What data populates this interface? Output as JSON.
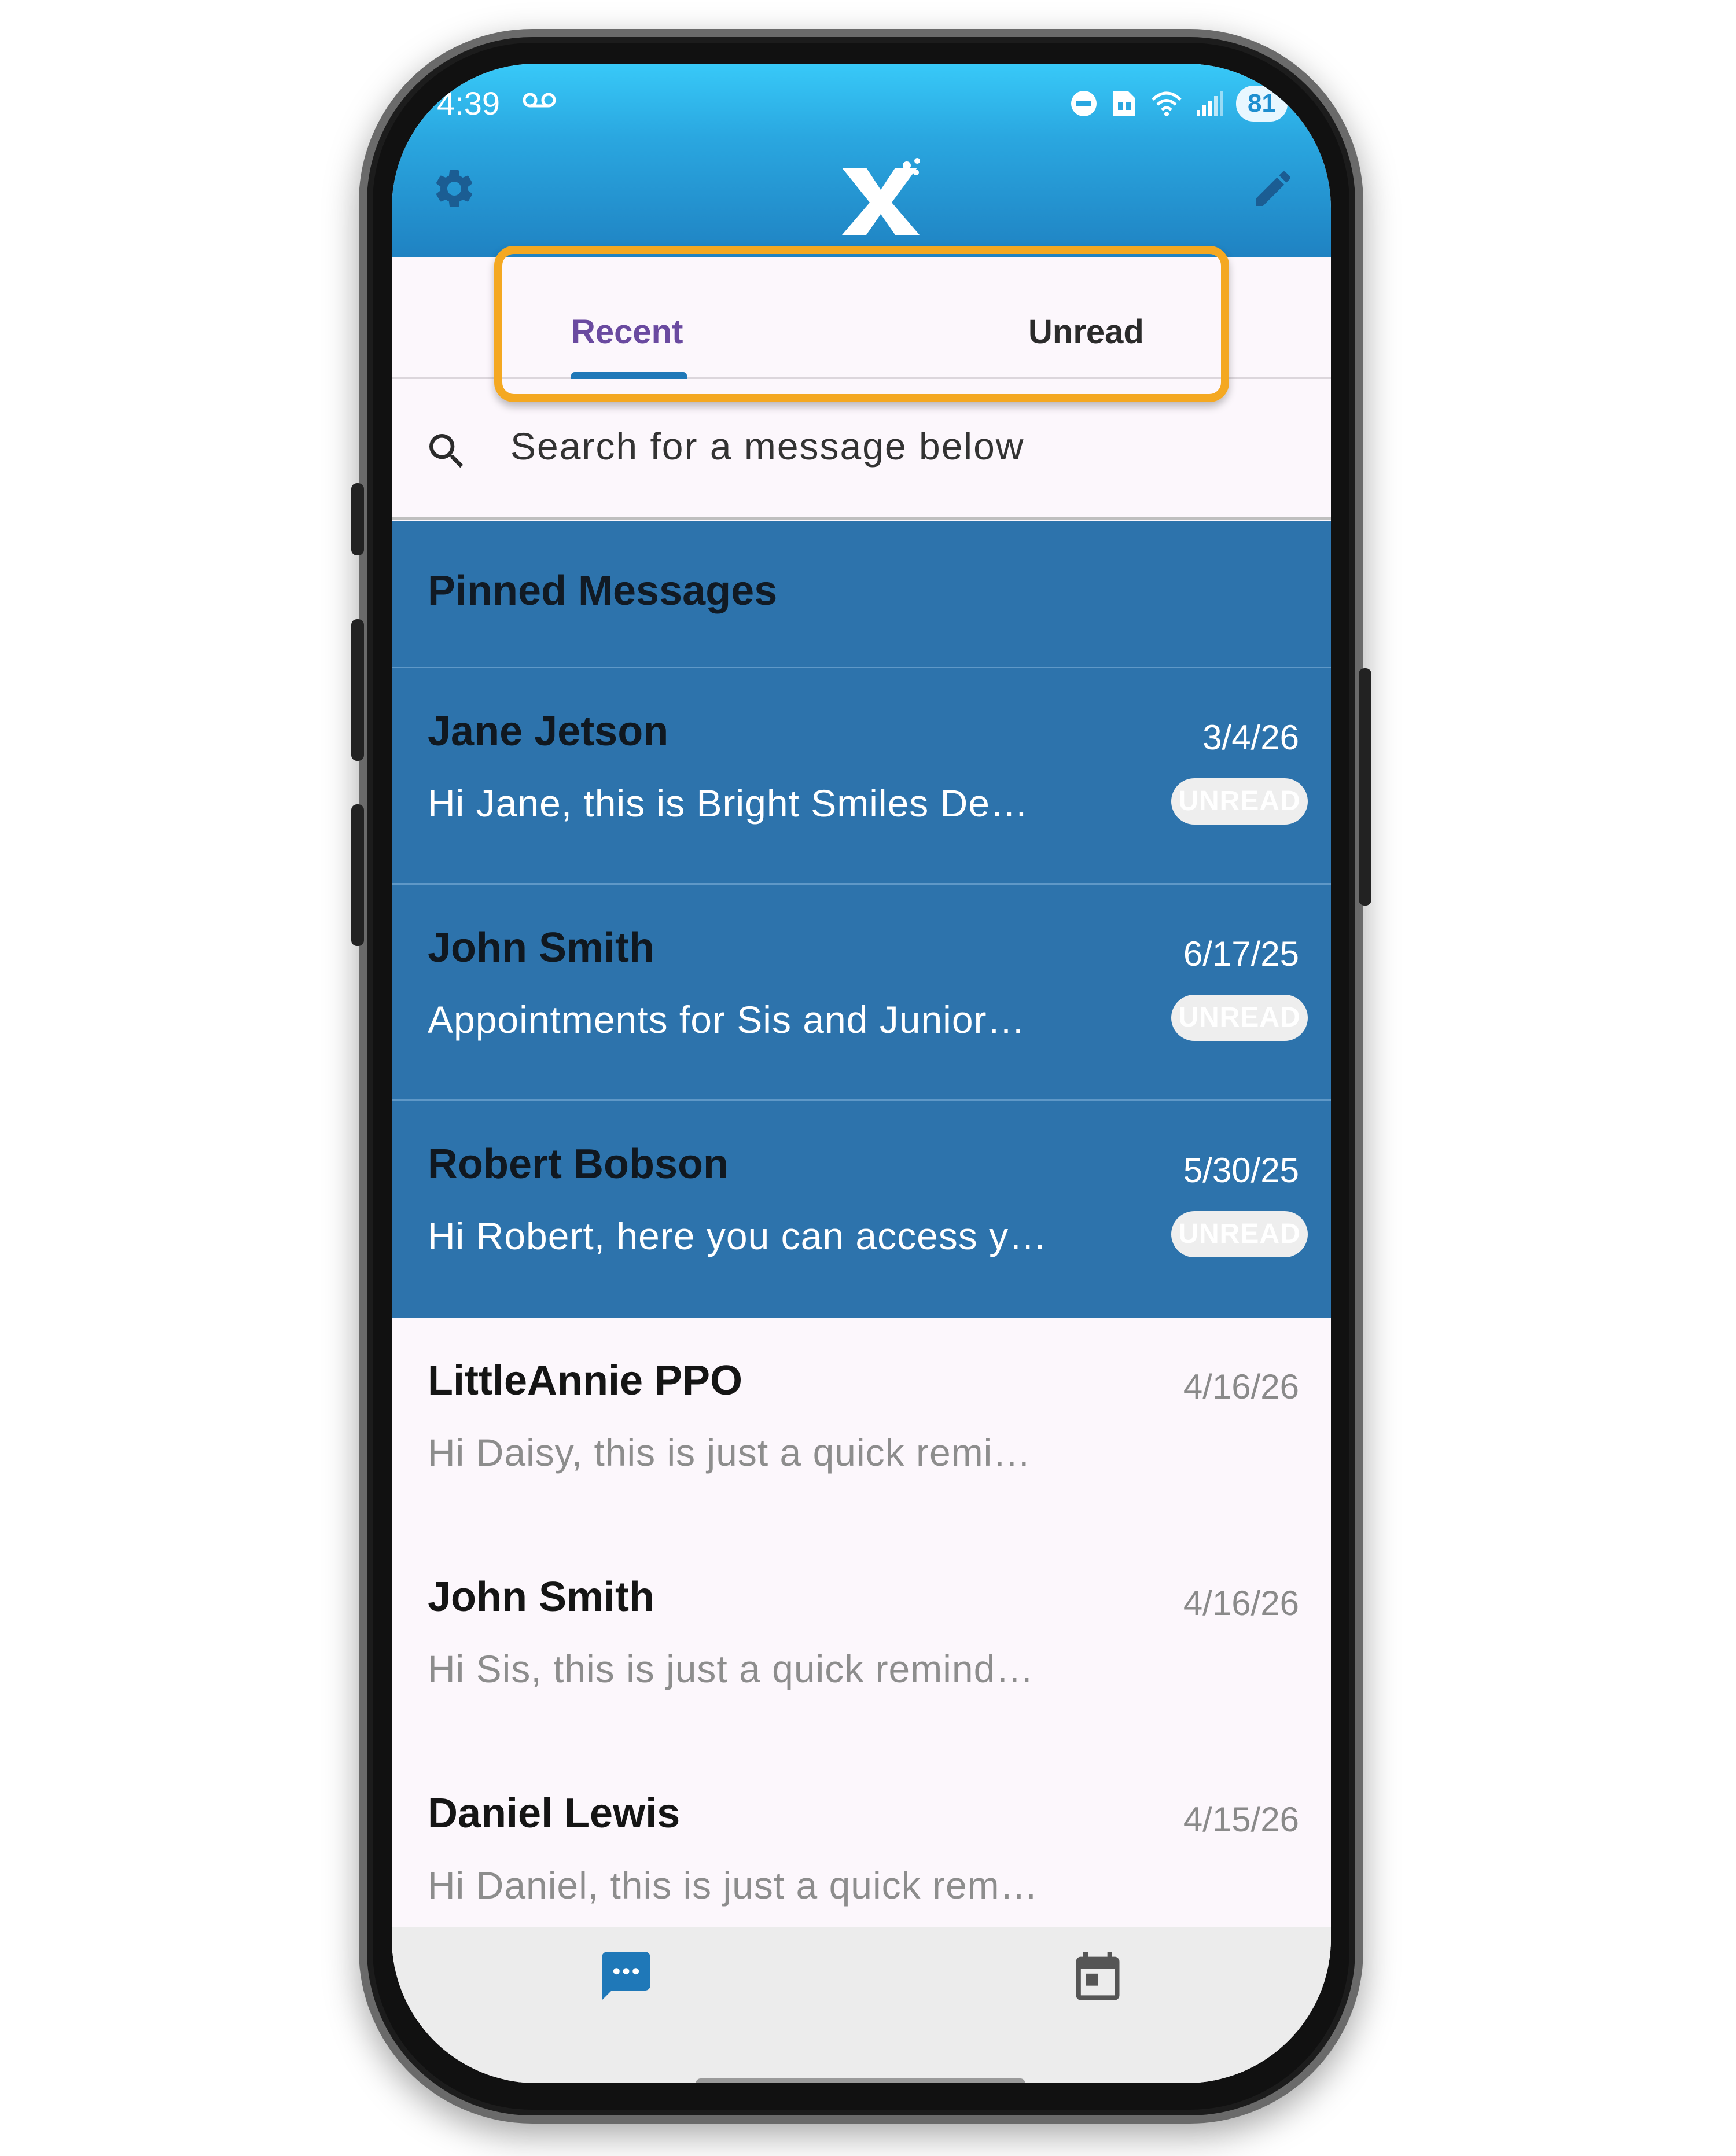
{
  "status_bar": {
    "time": "4:39",
    "battery": "81",
    "icons": [
      "voicemail-icon",
      "do-not-disturb-icon",
      "sim-icon",
      "wifi-icon",
      "signal-icon"
    ]
  },
  "header": {
    "logo_text": "X",
    "left_icon": "gear-icon",
    "right_icon": "pencil-icon",
    "colors": {
      "gradient_top": "#38c9f8",
      "gradient_bottom": "#1f82c2"
    }
  },
  "tabs": [
    {
      "label": "Recent",
      "selected": true
    },
    {
      "label": "Unread",
      "selected": false
    }
  ],
  "highlight_color": "#f4a821",
  "search": {
    "placeholder": "Search for a message below"
  },
  "pinned": {
    "title": "Pinned Messages",
    "color": "#2d73ac",
    "items": [
      {
        "name": "Jane Jetson",
        "preview": "Hi Jane, this is Bright Smiles De…",
        "date": "3/4/26",
        "badge": "UNREAD"
      },
      {
        "name": "John Smith",
        "preview": "Appointments for Sis and Junior…",
        "date": "6/17/25",
        "badge": "UNREAD"
      },
      {
        "name": "Robert Bobson",
        "preview": "Hi Robert, here you can access y…",
        "date": "5/30/25",
        "badge": "UNREAD"
      }
    ]
  },
  "messages": [
    {
      "name": "LittleAnnie PPO",
      "preview": "Hi Daisy, this is just a quick remi…",
      "date": "4/16/26"
    },
    {
      "name": "John Smith",
      "preview": "Hi Sis, this is just a quick remind…",
      "date": "4/16/26"
    },
    {
      "name": "Daniel Lewis",
      "preview": "Hi Daniel, this is just a quick rem…",
      "date": "4/15/26"
    }
  ],
  "bottom_nav": [
    {
      "icon": "chat-bubble-icon",
      "active": true
    },
    {
      "icon": "calendar-icon",
      "active": false
    }
  ]
}
